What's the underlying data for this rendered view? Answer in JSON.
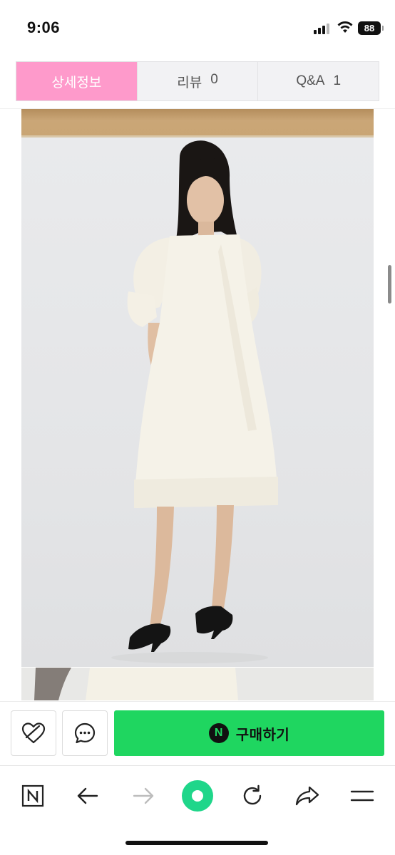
{
  "status_bar": {
    "time": "9:06",
    "battery": "88"
  },
  "tabs": [
    {
      "label": "상세정보",
      "count": "",
      "active": true
    },
    {
      "label": "리뷰",
      "count": "0",
      "active": false
    },
    {
      "label": "Q&A",
      "count": "1",
      "active": false
    }
  ],
  "product": {
    "image_icon": "product-photo-white-dress"
  },
  "action_bar": {
    "wishlist_icon": "heart-outline-icon",
    "chat_icon": "chat-bubble-icon",
    "buy_badge": "N",
    "buy_label": "구매하기",
    "buy_color": "#1fd660"
  },
  "nav_bar": {
    "items": [
      "naver-home-icon",
      "back-arrow-icon",
      "forward-arrow-icon",
      "green-dot-home-icon",
      "refresh-icon",
      "share-icon",
      "menu-icon"
    ]
  },
  "colors": {
    "active_tab": "#fe9acb",
    "accent_green": "#1fd660"
  }
}
